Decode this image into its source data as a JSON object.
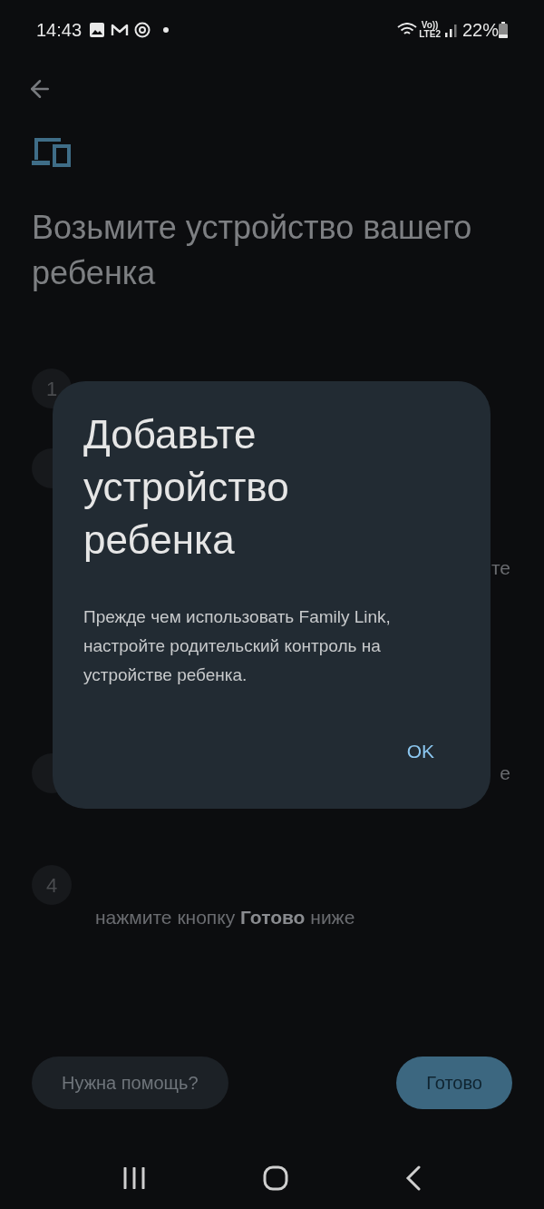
{
  "status_bar": {
    "time": "14:43",
    "network_label_top": "Vo))",
    "network_label_bottom": "LTE2",
    "battery": "22%"
  },
  "header": {
    "title": "Возьмите устройство вашего ребенка"
  },
  "steps": [
    {
      "number": "1"
    },
    {
      "text": "те"
    },
    {
      "text": "е"
    },
    {
      "number": "4",
      "text": "нажмите кнопку **Готово** ниже"
    }
  ],
  "dialog": {
    "title": "Добавьте устройство ребенка",
    "body": "Прежде чем использовать Family Link, настройте родительский контроль на устройстве ребенка.",
    "button": "OK"
  },
  "footer": {
    "buttons": [
      {
        "label": "Нужна помощь?",
        "kind": "secondary"
      },
      {
        "label": "Готово",
        "kind": "primary"
      }
    ]
  }
}
